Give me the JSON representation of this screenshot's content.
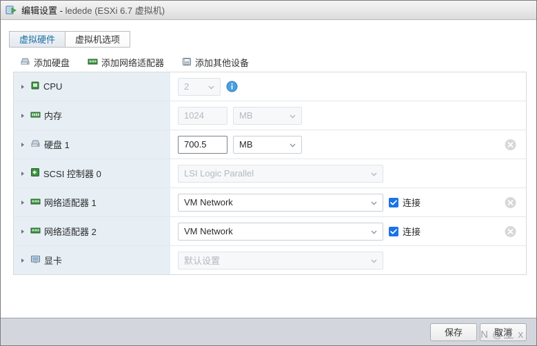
{
  "window": {
    "title_prefix": "编辑设置",
    "title_sep": " - ",
    "vm_name": "ledede (ESXi 6.7 虚拟机)",
    "icon": "vm-edit-icon"
  },
  "tabs": [
    {
      "label": "虚拟硬件",
      "active": true
    },
    {
      "label": "虚拟机选项",
      "active": false
    }
  ],
  "toolbar": {
    "add_disk": "添加硬盘",
    "add_network_adapter": "添加网络适配器",
    "add_other_device": "添加其他设备",
    "icons": [
      "hard-disk-icon",
      "network-adapter-icon",
      "other-device-icon"
    ]
  },
  "devices": [
    {
      "name": "CPU",
      "icon": "cpu-icon",
      "control": "select",
      "value": "2",
      "disabled": true,
      "info_icon": true,
      "removable": false
    },
    {
      "name": "内存",
      "icon": "memory-icon",
      "control": "number-unit",
      "value": "1024",
      "unit": "MB",
      "disabled": true,
      "removable": false
    },
    {
      "name": "硬盘 1",
      "icon": "hard-disk-icon",
      "control": "number-unit",
      "value": "700.5",
      "unit": "MB",
      "disabled": false,
      "removable": true
    },
    {
      "name": "SCSI 控制器 0",
      "icon": "scsi-controller-icon",
      "control": "select",
      "value": "LSI Logic Parallel",
      "disabled": true,
      "removable": false
    },
    {
      "name": "网络适配器 1",
      "icon": "network-adapter-icon",
      "control": "select-checkbox",
      "value": "VM Network",
      "disabled": false,
      "checkbox_label": "连接",
      "checked": true,
      "removable": true
    },
    {
      "name": "网络适配器 2",
      "icon": "network-adapter-icon",
      "control": "select-checkbox",
      "value": "VM Network",
      "disabled": false,
      "checkbox_label": "连接",
      "checked": true,
      "removable": true
    },
    {
      "name": "显卡",
      "icon": "graphics-card-icon",
      "control": "select",
      "value": "默认设置",
      "disabled": true,
      "removable": false
    }
  ],
  "footer": {
    "save_label": "保存",
    "cancel_label": "取消",
    "watermark": "N @王 x"
  },
  "colors": {
    "accent": "#1a73e8",
    "tab_active_text": "#1c6ea4",
    "row_label_bg": "#e7eff5",
    "footer_bg": "#d3d7dd",
    "disabled_text": "#b4b9bf"
  }
}
